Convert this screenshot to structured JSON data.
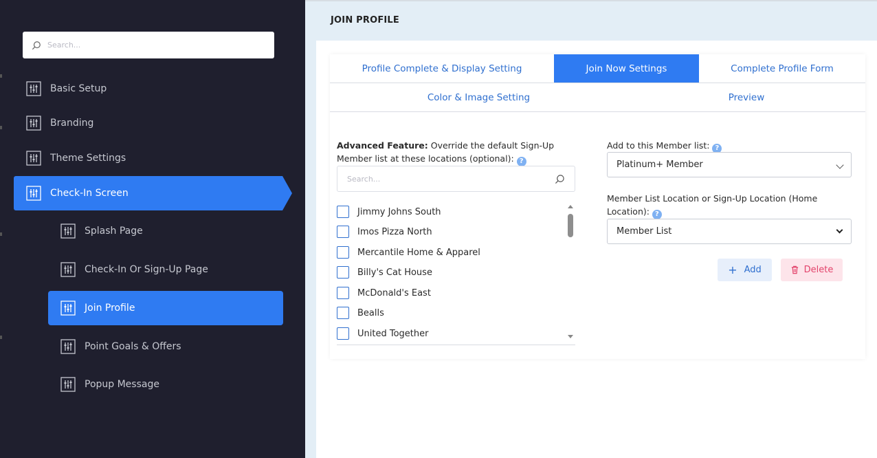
{
  "sidebar": {
    "search_placeholder": "Search...",
    "items": [
      {
        "label": "Basic Setup"
      },
      {
        "label": "Branding"
      },
      {
        "label": "Theme Settings"
      },
      {
        "label": "Check-In Screen"
      },
      {
        "label": "Splash Page"
      },
      {
        "label": "Check-In Or Sign-Up Page"
      },
      {
        "label": "Join Profile"
      },
      {
        "label": "Point Goals & Offers"
      },
      {
        "label": "Popup Message"
      }
    ]
  },
  "main": {
    "title": "JOIN PROFILE",
    "tabs": [
      {
        "label": "Profile Complete & Display Setting"
      },
      {
        "label": "Join Now Settings"
      },
      {
        "label": "Complete Profile Form"
      },
      {
        "label": "Color & Image Setting"
      },
      {
        "label": "Preview"
      }
    ],
    "advanced": {
      "bold": "Advanced Feature:",
      "text": " Override the default Sign-Up Member list at these locations (optional):",
      "help": "?"
    },
    "location_search_placeholder": "Search...",
    "locations": [
      {
        "name": "Jimmy Johns South"
      },
      {
        "name": "Imos Pizza North"
      },
      {
        "name": "Mercantile Home & Apparel"
      },
      {
        "name": "Billy's Cat House"
      },
      {
        "name": "McDonald's East"
      },
      {
        "name": "Bealls"
      },
      {
        "name": "United Together"
      }
    ],
    "member_list_label": "Add to this Member list:",
    "member_list_value": "Platinum+ Member",
    "location_label": "Member List Location or Sign-Up Location (Home Location):",
    "location_value": "Member List",
    "help": "?",
    "add_label": "Add",
    "add_icon": "+",
    "delete_label": "Delete"
  },
  "colors": {
    "sidebar_bg": "#1f1f2e",
    "accent": "#2f7bf2",
    "header_bg": "#e3eef6",
    "delete": "#e3436b"
  }
}
